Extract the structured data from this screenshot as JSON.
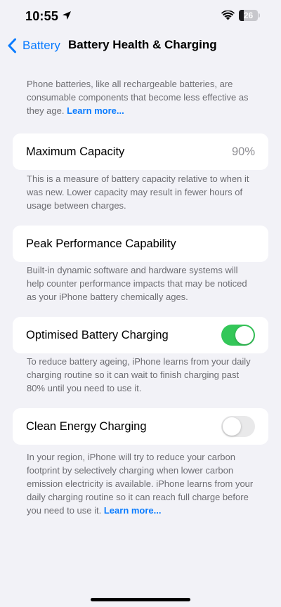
{
  "status_bar": {
    "time": "10:55",
    "battery_level": "26",
    "battery_fraction": 0.26
  },
  "nav": {
    "back_label": "Battery",
    "title": "Battery Health & Charging"
  },
  "intro": {
    "text": "Phone batteries, like all rechargeable batteries, are consumable components that become less effective as they age. ",
    "link": "Learn more..."
  },
  "maximum_capacity": {
    "label": "Maximum Capacity",
    "value": "90%",
    "footnote": "This is a measure of battery capacity relative to when it was new. Lower capacity may result in fewer hours of usage between charges."
  },
  "peak_performance": {
    "label": "Peak Performance Capability",
    "footnote": "Built-in dynamic software and hardware systems will help counter performance impacts that may be noticed as your iPhone battery chemically ages."
  },
  "optimised_charging": {
    "label": "Optimised Battery Charging",
    "enabled": true,
    "footnote": "To reduce battery ageing, iPhone learns from your daily charging routine so it can wait to finish charging past 80% until you need to use it."
  },
  "clean_energy": {
    "label": "Clean Energy Charging",
    "enabled": false,
    "footnote": "In your region, iPhone will try to reduce your carbon footprint by selectively charging when lower carbon emission electricity is available. iPhone learns from your daily charging routine so it can reach full charge before you need to use it. ",
    "link": "Learn more..."
  },
  "colors": {
    "accent": "#0a7cff",
    "toggle_on": "#34c759",
    "background": "#f2f2f7"
  },
  "icons": [
    "location-arrow-icon",
    "wifi-icon",
    "battery-icon",
    "chevron-left-icon"
  ]
}
